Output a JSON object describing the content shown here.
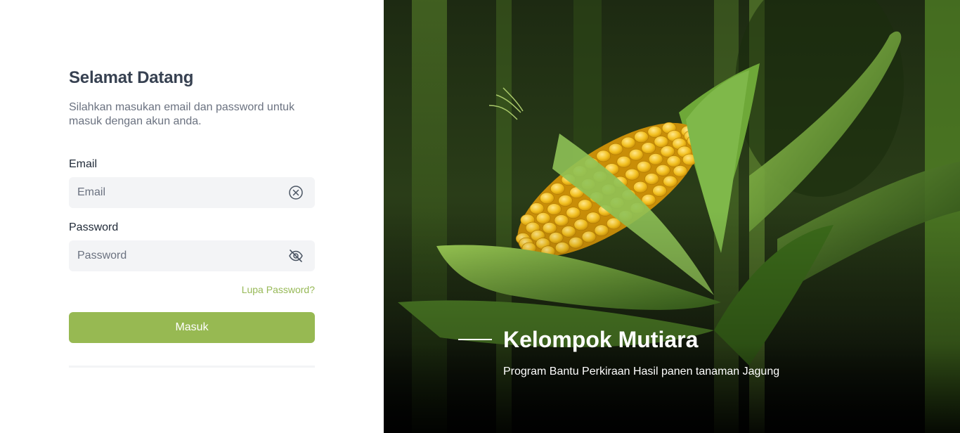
{
  "login": {
    "title": "Selamat Datang",
    "subtitle": "Silahkan masukan email dan password untuk masuk dengan akun anda.",
    "email_label": "Email",
    "email_placeholder": "Email",
    "email_value": "",
    "password_label": "Password",
    "password_placeholder": "Password",
    "password_value": "",
    "forgot_link": "Lupa Password?",
    "submit_label": "Masuk",
    "icons": {
      "email_clear": "circle-x-icon",
      "password_toggle": "eye-off-icon"
    }
  },
  "hero": {
    "title": "Kelompok Mutiara",
    "subtitle": "Program Bantu Perkiraan Hasil panen tanaman Jagung",
    "image": "corn-cob-photo"
  },
  "colors": {
    "accent": "#97b952",
    "link": "#97b957",
    "heading": "#374151",
    "muted": "#6b7280",
    "field_bg": "#f3f4f6"
  }
}
